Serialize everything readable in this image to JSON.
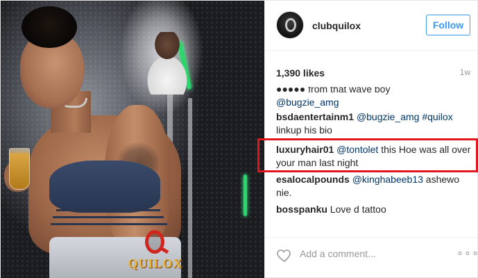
{
  "account": {
    "username": "clubquilox",
    "follow_label": "Follow"
  },
  "post": {
    "likes": "1,390 likes",
    "time": "1w",
    "brand_logo_text": "QUILOX"
  },
  "comments": [
    {
      "username": "",
      "text": "●●●●● from that wave boy",
      "mention": "@bugzie_amg",
      "after": ""
    },
    {
      "username": "bsdaentertainm1",
      "mention": "@bugzie_amg",
      "tag": "#quilox",
      "text": "linkup his bio"
    },
    {
      "username": "luxuryhair01",
      "mention": "@tontolet",
      "text": "this Hoe was all over your man last night"
    },
    {
      "username": "esalocalpounds",
      "mention": "@kinghabeeb13",
      "text": "ashewo nie."
    },
    {
      "username": "bosspanku",
      "text": "Love d tattoo"
    }
  ],
  "composer": {
    "placeholder": "Add a comment...",
    "more_label": "∘∘∘"
  },
  "colors": {
    "accent": "#3897f0",
    "highlight_border": "#e0161f",
    "mention": "#003569"
  },
  "icons": {
    "like": "heart-icon",
    "options": "more-options-icon"
  }
}
